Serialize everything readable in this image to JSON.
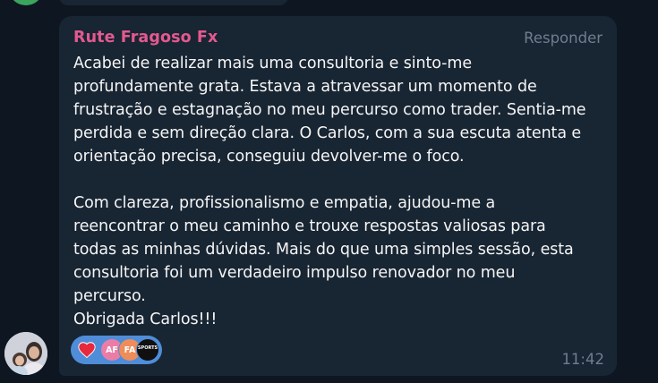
{
  "message": {
    "sender": "Rute Fragoso Fx",
    "reply_label": "Responder",
    "text": "Acabei de realizar mais uma consultoria e sinto-me\nprofundamente grata. Estava a atravessar um momento de\nfrustração e estagnação no meu percurso como trader. Sentia-me\nperdida e sem direção clara. O Carlos, com a sua escuta atenta e\norientação precisa, conseguiu devolver-me o foco.\n\nCom clareza, profissionalismo e empatia, ajudou-me a\nreencontrar o meu caminho e trouxe respostas valiosas para\ntodas as minhas dúvidas. Mais do que uma simples sessão, esta\nconsultoria foi um verdadeiro impulso renovador no meu\npercurso.\nObrigada Carlos!!!",
    "time": "11:42",
    "reactions": {
      "emoji_icon": "red-heart-icon",
      "avatars": [
        "AF",
        "FA",
        "SPORTS"
      ]
    }
  },
  "colors": {
    "background": "#0e1621",
    "bubble": "#182533",
    "sender": "#e4598f",
    "reaction_pill": "#4f8dd8"
  }
}
